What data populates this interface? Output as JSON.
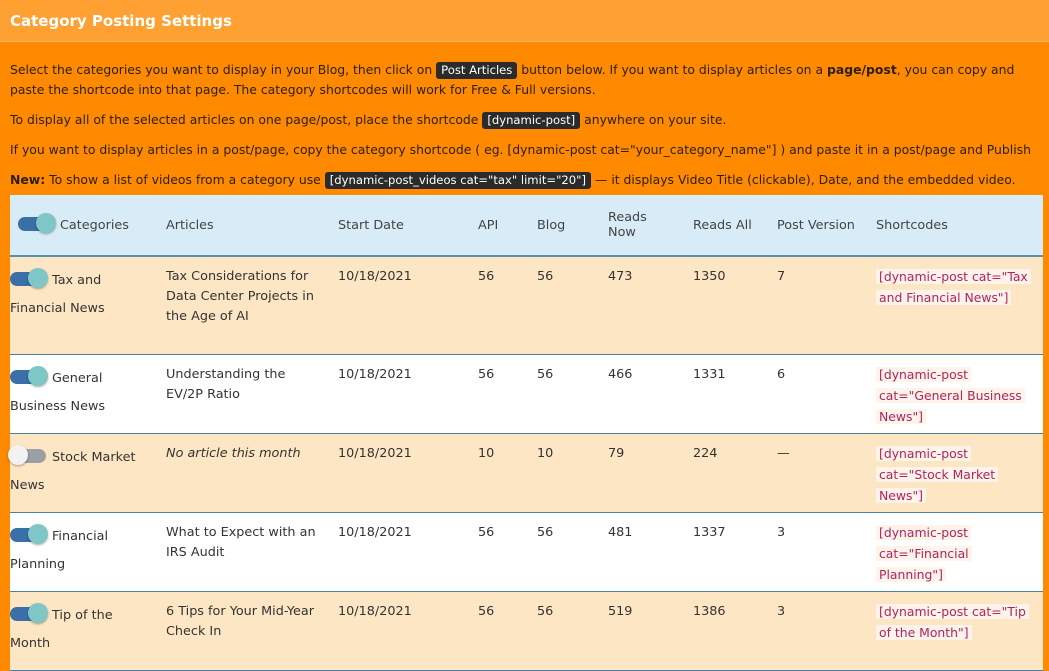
{
  "header": {
    "title": "Category Posting Settings"
  },
  "intro": {
    "line1_a": "Select the categories you want to display in your Blog, then click on",
    "post_articles_label": "Post Articles",
    "line1_b": "button below. If you want to display articles on a",
    "line1_bold": "page/post",
    "line1_c": ", you can copy and paste the shortcode into that page. The category shortcodes will work for Free & Full versions.",
    "line2_a": "To display all of the selected articles on one page/post, place the shortcode",
    "line2_code": "[dynamic-post]",
    "line2_b": "anywhere on your site.",
    "line3": "If you want to display articles in a post/page, copy the category shortcode ( eg. [dynamic-post cat=\"your_category_name\"] ) and paste it in a post/page and Publish",
    "line4_bold": "New:",
    "line4_a": "To show a list of videos from a category use",
    "line4_code": "[dynamic-post_videos cat=\"tax\" limit=\"20\"]",
    "line4_b": "— it displays Video Title (clickable), Date, and the embedded video."
  },
  "table": {
    "headers": [
      "Categories",
      "Articles",
      "Start Date",
      "API",
      "Blog",
      "Reads Now",
      "Reads All",
      "Post Version",
      "Shortcodes"
    ],
    "rows": [
      {
        "enabled": true,
        "category": "Tax and Financial News",
        "article": "Tax Considerations for Data Center Projects in the Age of AI",
        "article_italic": false,
        "start_date": "10/18/2021",
        "api": "56",
        "blog": "56",
        "reads_now": "473",
        "reads_all": "1350",
        "post_version": "7",
        "shortcode": "[dynamic-post cat=\"Tax and Financial News\"]"
      },
      {
        "enabled": true,
        "category": "General Business News",
        "article": "Understanding the EV/2P Ratio",
        "article_italic": false,
        "start_date": "10/18/2021",
        "api": "56",
        "blog": "56",
        "reads_now": "466",
        "reads_all": "1331",
        "post_version": "6",
        "shortcode": "[dynamic-post cat=\"General Business News\"]"
      },
      {
        "enabled": false,
        "category": "Stock Market News",
        "article": "No article this month",
        "article_italic": true,
        "start_date": "10/18/2021",
        "api": "10",
        "blog": "10",
        "reads_now": "79",
        "reads_all": "224",
        "post_version": "—",
        "shortcode": "[dynamic-post cat=\"Stock Market News\"]"
      },
      {
        "enabled": true,
        "category": "Financial Planning",
        "article": "What to Expect with an IRS Audit",
        "article_italic": false,
        "start_date": "10/18/2021",
        "api": "56",
        "blog": "56",
        "reads_now": "481",
        "reads_all": "1337",
        "post_version": "3",
        "shortcode": "[dynamic-post cat=\"Financial Planning\"]"
      },
      {
        "enabled": true,
        "category": "Tip of the Month",
        "article": "6 Tips for Your Mid-Year Check In",
        "article_italic": false,
        "start_date": "10/18/2021",
        "api": "56",
        "blog": "56",
        "reads_now": "519",
        "reads_all": "1386",
        "post_version": "3",
        "shortcode": "[dynamic-post cat=\"Tip of the Month\"]"
      }
    ]
  },
  "colors": {
    "toggle_on": "#3a6fa8",
    "knob_on": "#7fc7c6",
    "toggle_off": "#9aa0a6",
    "shortcode_text": "#b0245f"
  }
}
